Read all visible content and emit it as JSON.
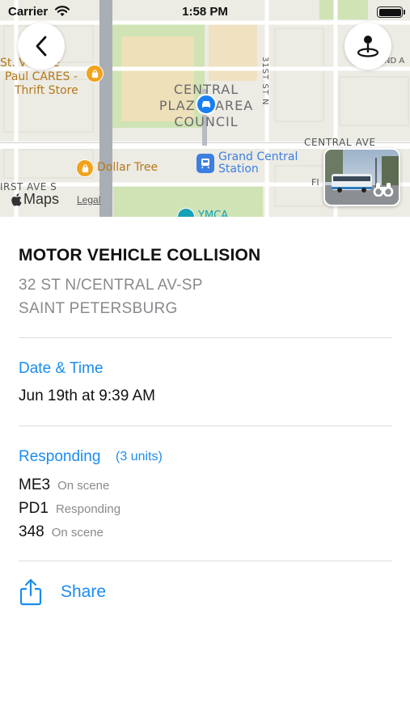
{
  "status_bar": {
    "carrier": "Carrier",
    "time": "1:58 PM"
  },
  "map": {
    "labels": {
      "poi_thrift": "St. Vincent de Paul CARES - Thrift Store",
      "poi_thrift_line1": "St. V     nt de",
      "poi_thrift_line2": "Paul CARES -",
      "poi_thrift_line3": "Thrift Store",
      "council_line1": "CENTRAL",
      "council_line2": "PLAZ    AREA",
      "council_line3": "COUNCIL",
      "street_31st": "31ST ST N",
      "central_ave": "CENTRAL AVE",
      "dollar_tree": "Dollar Tree",
      "station_line1": "Grand Central",
      "station_line2": "Station",
      "first_ave": "IRST AVE S",
      "ymca": "YMCA",
      "partial_right_1": "ND A",
      "partial_right_2": "FI"
    },
    "attribution": {
      "maps": "Maps",
      "legal": "Legal"
    }
  },
  "incident": {
    "title": "MOTOR VEHICLE COLLISION",
    "address_line1": "32 ST N/CENTRAL AV-SP",
    "address_line2": "SAINT PETERSBURG"
  },
  "date_time": {
    "label": "Date & Time",
    "value": "Jun 19th at 9:39 AM"
  },
  "responding": {
    "label": "Responding",
    "count": "(3 units)",
    "units": [
      {
        "id": "ME3",
        "status": "On scene"
      },
      {
        "id": "PD1",
        "status": "Responding"
      },
      {
        "id": "348",
        "status": "On scene"
      }
    ]
  },
  "actions": {
    "share": "Share"
  },
  "colors": {
    "accent": "#1a8cf0",
    "secondary_text": "#8a8a8e"
  }
}
